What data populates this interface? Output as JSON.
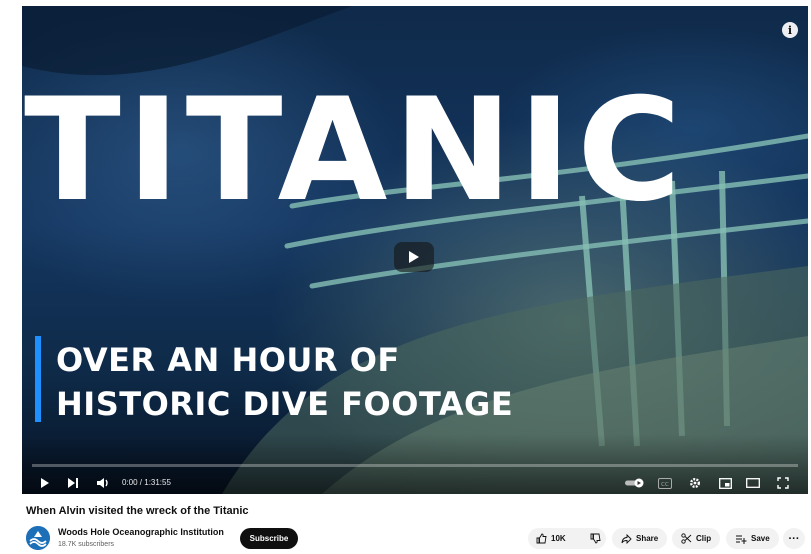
{
  "video": {
    "title_overlay": "TITANIC",
    "subtitle_line1": "OVER AN HOUR OF",
    "subtitle_line2": "HISTORIC DIVE FOOTAGE",
    "time_display": "0:00 / 1:31:55",
    "progress_fraction": 0.0
  },
  "page": {
    "video_title": "When Alvin visited the wreck of the Titanic"
  },
  "channel": {
    "name": "Woods Hole Oceanographic Institution",
    "subscribers": "18.7K subscribers",
    "subscribe_label": "Subscribe"
  },
  "actions": {
    "like_count": "10K",
    "share_label": "Share",
    "clip_label": "Clip",
    "save_label": "Save",
    "more_label": "···"
  },
  "colors": {
    "accent_bar": "#1e90ff",
    "subscribe_bg": "#0f0f0f",
    "progress": "#ff0000"
  },
  "icons": [
    "info-icon",
    "play-icon",
    "next-icon",
    "volume-icon",
    "autoplay-toggle-icon",
    "captions-icon",
    "settings-icon",
    "miniplayer-icon",
    "theater-icon",
    "fullscreen-icon",
    "thumbs-up-icon",
    "thumbs-down-icon",
    "share-icon",
    "scissors-icon",
    "save-playlist-icon"
  ]
}
